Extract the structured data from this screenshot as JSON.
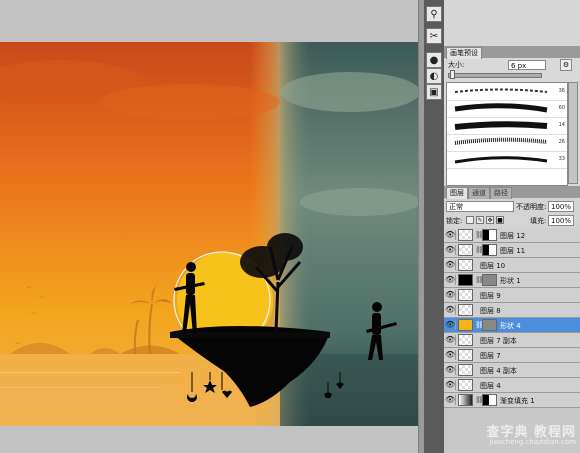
{
  "tools": [
    {
      "icon": "stamp-icon",
      "glyph": "⚲"
    },
    {
      "icon": "scissors-icon",
      "glyph": "✂"
    },
    {
      "icon": "brush-icon",
      "glyph": "●"
    },
    {
      "icon": "settings-icon",
      "glyph": "◐"
    },
    {
      "icon": "camera-icon",
      "glyph": "▣"
    }
  ],
  "brush_panel": {
    "tab": "画笔预设",
    "size_label": "大小:",
    "size_value": "6 px",
    "stroke_sizes": [
      "36",
      "60",
      "14",
      "26",
      "33"
    ]
  },
  "layers_panel": {
    "tabs": [
      "图层",
      "通道",
      "路径"
    ],
    "blend_mode": "正常",
    "opacity_label": "不透明度:",
    "opacity_value": "100%",
    "lock_label": "锁定:",
    "fill_label": "填充:",
    "fill_value": "100%",
    "layers": [
      {
        "name": "图层 12",
        "thumb": "checker",
        "mask": true
      },
      {
        "name": "图层 11",
        "thumb": "checker",
        "mask": true
      },
      {
        "name": "图层 10",
        "thumb": "checker",
        "mask": false
      },
      {
        "name": "形状 1",
        "thumb": "black",
        "mask": true
      },
      {
        "name": "图层 9",
        "thumb": "checker",
        "mask": false
      },
      {
        "name": "图层 8",
        "thumb": "checker",
        "mask": false
      },
      {
        "name": "形状 4",
        "thumb": "gold",
        "mask": true,
        "selected": true
      },
      {
        "name": "图层 7 副本",
        "thumb": "checker",
        "mask": false
      },
      {
        "name": "图层 7",
        "thumb": "checker",
        "mask": false
      },
      {
        "name": "图层 4 副本",
        "thumb": "checker",
        "mask": false
      },
      {
        "name": "图层 4",
        "thumb": "checker",
        "mask": false
      },
      {
        "name": "渐变填充 1",
        "thumb": "gradient",
        "mask": true
      }
    ]
  },
  "watermark": {
    "line1": "查字典 教程网",
    "line2": "jiaocheng.chazidian.com"
  },
  "colors": {
    "sunset_orange": "#e8701a",
    "teal_sky": "#3f5e58",
    "selection_blue": "#4c8edb",
    "sun_gold": "#f5b21a"
  }
}
